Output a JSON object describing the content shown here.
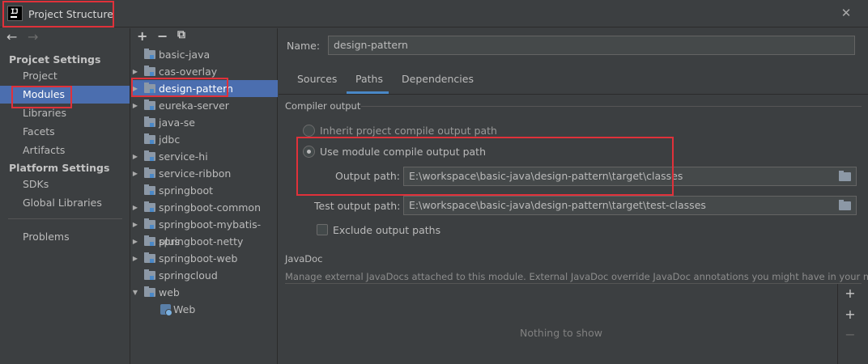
{
  "window": {
    "title": "Project Structure",
    "app_icon_text": "IJ",
    "close_glyph": "✕"
  },
  "sidebar": {
    "back_glyph": "←",
    "forward_glyph": "→",
    "project_settings_header": "Projcet Settings",
    "project_items": [
      "Project",
      "Modules",
      "Libraries",
      "Facets",
      "Artifacts"
    ],
    "platform_settings_header": "Platform Settings",
    "platform_items": [
      "SDKs",
      "Global Libraries"
    ],
    "other_items": [
      "Problems"
    ],
    "selected": "Modules"
  },
  "tree": {
    "toolbar": {
      "add": "+",
      "remove": "−",
      "copy": "⧉"
    },
    "items": [
      {
        "label": "basic-java",
        "expandable": false
      },
      {
        "label": "cas-overlay",
        "expandable": true
      },
      {
        "label": "design-pattern",
        "expandable": true,
        "selected": true
      },
      {
        "label": "eureka-server",
        "expandable": true
      },
      {
        "label": "java-se",
        "expandable": false
      },
      {
        "label": "jdbc",
        "expandable": false
      },
      {
        "label": "service-hi",
        "expandable": true
      },
      {
        "label": "service-ribbon",
        "expandable": true
      },
      {
        "label": "springboot",
        "expandable": false
      },
      {
        "label": "springboot-common",
        "expandable": true
      },
      {
        "label": "springboot-mybatis-plus",
        "expandable": true
      },
      {
        "label": "springboot-netty",
        "expandable": true
      },
      {
        "label": "springboot-web",
        "expandable": true
      },
      {
        "label": "springcloud",
        "expandable": false
      },
      {
        "label": "web",
        "expandable": true,
        "expanded": true
      },
      {
        "label": "Web",
        "child": true,
        "icon": "web-facet-icon"
      }
    ]
  },
  "main": {
    "name_label": "Name:",
    "name_value": "design-pattern",
    "tabs": [
      {
        "label": "Sources"
      },
      {
        "label": "Paths",
        "active": true
      },
      {
        "label": "Dependencies"
      }
    ],
    "compiler_output": {
      "title": "Compiler output",
      "inherit_label": "Inherit project compile output path",
      "use_module_label": "Use module compile output path",
      "selected": "use_module",
      "output_path_label": "Output path:",
      "output_path_value": "E:\\workspace\\basic-java\\design-pattern\\target\\classes",
      "test_output_path_label": "Test output path:",
      "test_output_path_value": "E:\\workspace\\basic-java\\design-pattern\\target\\test-classes",
      "exclude_label": "Exclude output paths",
      "exclude_checked": false
    },
    "javadoc": {
      "title": "JavaDoc",
      "description": "Manage external JavaDocs attached to this module. External JavaDoc override JavaDoc annotations you might have in your module.",
      "empty_text": "Nothing to show",
      "tools": {
        "add": "+",
        "add_url": "+",
        "remove": "−"
      }
    }
  },
  "colors": {
    "background": "#3c3f41",
    "selection": "#4b6eaf",
    "highlight_box": "#e0313a",
    "tab_underline": "#4a88c7"
  }
}
